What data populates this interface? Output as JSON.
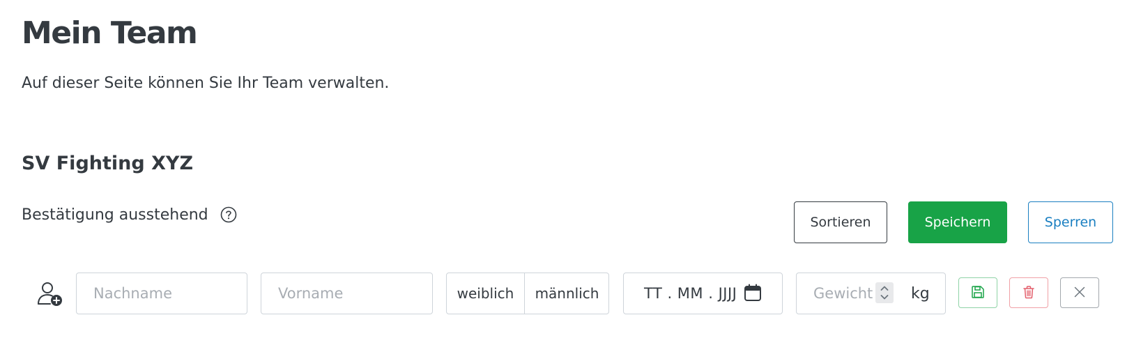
{
  "page": {
    "title": "Mein Team",
    "description": "Auf dieser Seite können Sie Ihr Team verwalten."
  },
  "team": {
    "name": "SV Fighting XYZ",
    "status": "Bestätigung ausstehend",
    "help_icon": "question-circle-icon"
  },
  "toolbar": {
    "sort_label": "Sortieren",
    "save_label": "Speichern",
    "lock_label": "Sperren"
  },
  "new_member": {
    "add_icon": "user-add-icon",
    "lastname_placeholder": "Nachname",
    "firstname_placeholder": "Vorname",
    "gender_options": [
      "weiblich",
      "männlich"
    ],
    "date_placeholder": "TT . MM . JJJJ",
    "calendar_icon": "calendar-icon",
    "weight_placeholder": "Gewicht",
    "weight_unit": "kg",
    "save_icon": "floppy-disk-icon",
    "delete_icon": "trash-icon",
    "close_icon": "close-icon"
  },
  "colors": {
    "text": "#343a40",
    "success": "#18a347",
    "primary": "#1a7fc1",
    "danger": "#e35d6a",
    "border": "#ced4da"
  }
}
